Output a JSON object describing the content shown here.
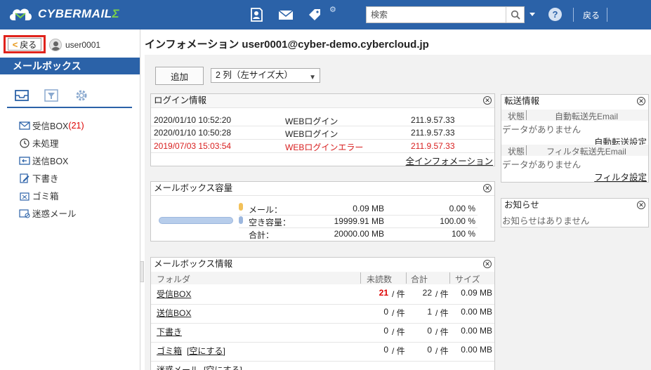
{
  "header": {
    "brand": "CYBERMAIL",
    "brand_suffix": "Σ",
    "search_placeholder": "検索",
    "back_label": "戻る"
  },
  "sidebar": {
    "back_label": "戻る",
    "user": "user0001",
    "mailbox_title": "メールボックス",
    "folders": [
      {
        "label": "受信BOX",
        "count": "(21)"
      },
      {
        "label": "未処理",
        "count": ""
      },
      {
        "label": "送信BOX",
        "count": ""
      },
      {
        "label": "下書き",
        "count": ""
      },
      {
        "label": "ゴミ箱",
        "count": ""
      },
      {
        "label": "迷惑メール",
        "count": ""
      }
    ]
  },
  "main": {
    "title": "インフォメーション user0001@cyber-demo.cybercloud.jp",
    "add_label": "追加",
    "column_option": "2 列（左サイズ大）"
  },
  "login_panel": {
    "title": "ログイン情報",
    "rows": [
      {
        "time": "2020/01/10 10:52:20",
        "type": "WEBログイン",
        "ip": "211.9.57.33",
        "error": false
      },
      {
        "time": "2020/01/10 10:50:28",
        "type": "WEBログイン",
        "ip": "211.9.57.33",
        "error": false
      },
      {
        "time": "2019/07/03 15:03:54",
        "type": "WEBログインエラー",
        "ip": "211.9.57.33",
        "error": true
      }
    ],
    "all_link": "全インフォメーション"
  },
  "capacity_panel": {
    "title": "メールボックス容量",
    "usage_fraction": 4.5e-06,
    "rows": [
      {
        "label": "メール：",
        "value": "0.09 MB",
        "pct": "0.00 %"
      },
      {
        "label": "空き容量：",
        "value": "19999.91 MB",
        "pct": "100.00 %"
      },
      {
        "label": "合計：",
        "value": "20000.00 MB",
        "pct": "100 %"
      }
    ]
  },
  "mbinfo_panel": {
    "title": "メールボックス情報",
    "headers": {
      "folder": "フォルダ",
      "unread": "未読数",
      "total": "合計",
      "size": "サイズ"
    },
    "unit": "/ 件",
    "empty_label": "[空にする]",
    "rows": [
      {
        "folder": "受信BOX",
        "empty": false,
        "unread": "21",
        "total": "22",
        "size": "0.09 MB"
      },
      {
        "folder": "送信BOX",
        "empty": false,
        "unread": "0",
        "total": "1",
        "size": "0.00 MB"
      },
      {
        "folder": "下書き",
        "empty": false,
        "unread": "0",
        "total": "0",
        "size": "0.00 MB"
      },
      {
        "folder": "ゴミ箱",
        "empty": true,
        "unread": "0",
        "total": "0",
        "size": "0.00 MB"
      },
      {
        "folder": "迷惑メール",
        "empty": true,
        "unread": "",
        "total": "",
        "size": ""
      }
    ]
  },
  "forward_panel": {
    "title": "転送情報",
    "status_label": "状態",
    "auto_header": "自動転送先Email",
    "no_data": "データがありません",
    "auto_link": "自動転送設定",
    "filter_header": "フィルタ転送先Email",
    "filter_link": "フィルタ設定"
  },
  "notice_panel": {
    "title": "お知らせ",
    "text": "お知らせはありません"
  }
}
